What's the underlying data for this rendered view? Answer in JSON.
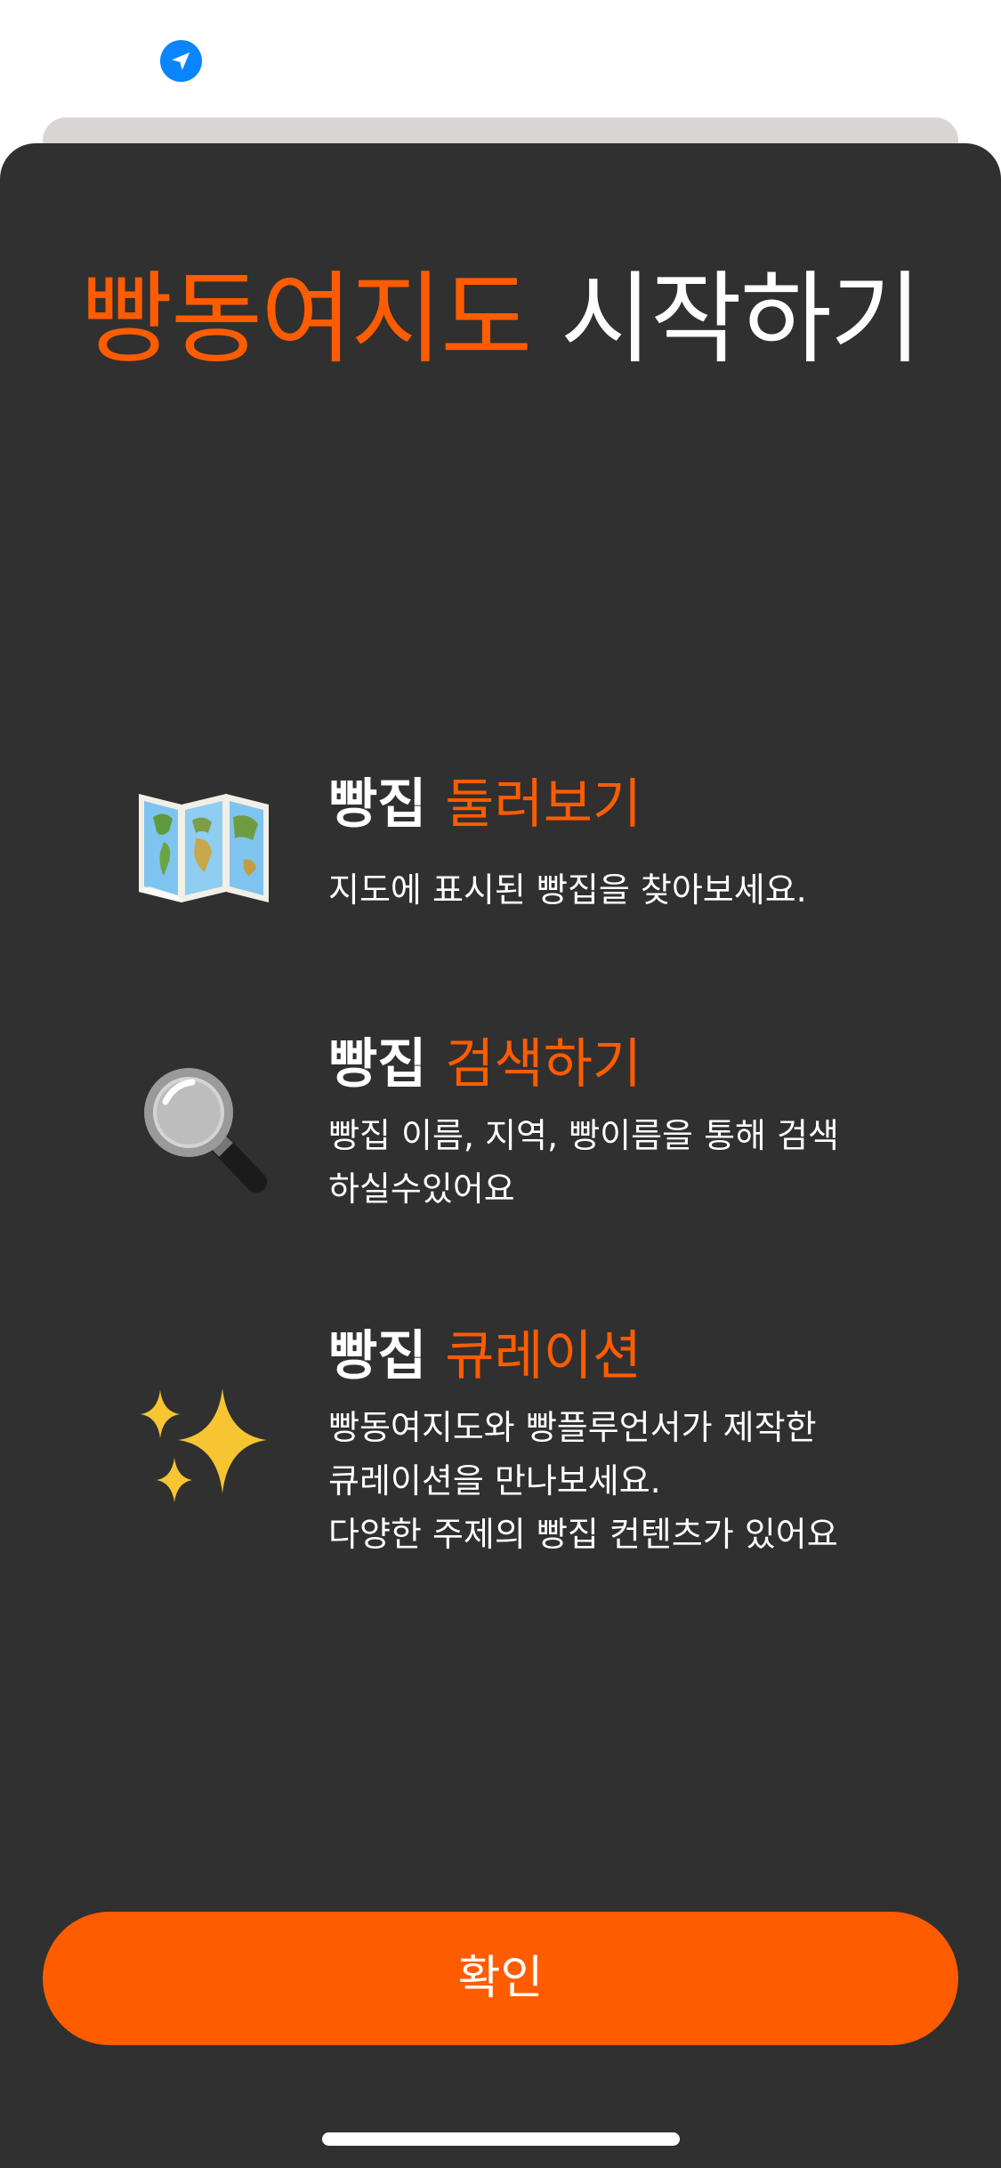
{
  "icons": {
    "location": "location-arrow-icon",
    "map": "world-map-icon",
    "search": "magnifying-glass-icon",
    "curation": "sparkles-icon"
  },
  "colors": {
    "accent": "#ff5c00",
    "sheet_background": "#303030",
    "underlay": "#d9d5d4",
    "location_blue": "#0a84ff",
    "text": "#ffffff"
  },
  "modal": {
    "title_accent": "빵동여지도",
    "title_rest": "시작하기"
  },
  "features": [
    {
      "heading_prefix": "빵집",
      "heading_accent": "둘러보기",
      "description": "지도에 표시된 빵집을 찾아보세요."
    },
    {
      "heading_prefix": "빵집",
      "heading_accent": "검색하기",
      "description": "빵집 이름, 지역, 빵이름을 통해 검색\n하실수있어요"
    },
    {
      "heading_prefix": "빵집",
      "heading_accent": "큐레이션",
      "description": "빵동여지도와 빵플루언서가 제작한\n큐레이션을 만나보세요.\n다양한 주제의 빵집 컨텐츠가 있어요"
    }
  ],
  "confirm_label": "확인"
}
